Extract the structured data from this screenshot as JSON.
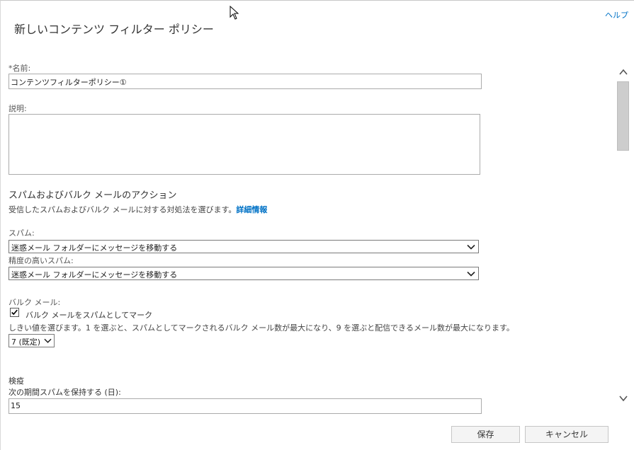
{
  "header": {
    "title": "新しいコンテンツ フィルター ポリシー",
    "help_link": "ヘルプ"
  },
  "form": {
    "name_label": "*名前:",
    "name_value": "コンテンツフィルターポリシー①",
    "description_label": "説明:",
    "description_value": "",
    "spam_section": {
      "title": "スパムおよびバルク メールのアクション",
      "description": "受信したスパムおよびバルク メールに対する対処法を選びます。",
      "more_info_link": "詳細情報",
      "spam_label": "スパム:",
      "spam_selected": "迷惑メール フォルダーにメッセージを移動する",
      "high_confidence_label": "精度の高いスパム:",
      "high_confidence_selected": "迷惑メール フォルダーにメッセージを移動する"
    },
    "bulk_section": {
      "label": "バルク メール:",
      "checkbox_label": "バルク メールをスパムとしてマーク",
      "checkbox_checked": true,
      "threshold_description": "しきい値を選びます。1 を選ぶと、スパムとしてマークされるバルク メール数が最大になり、9 を選ぶと配信できるメール数が最大になります。",
      "threshold_selected": "7 (既定)"
    },
    "quarantine_section": {
      "title": "検疫",
      "retention_label": "次の期間スパムを保持する (日):",
      "retention_value": "15"
    }
  },
  "footer": {
    "save_label": "保存",
    "cancel_label": "キャンセル"
  },
  "icons": {
    "chevron": "chevron-down-icon",
    "scroll_up": "chevron-up-icon",
    "scroll_down": "chevron-down-icon",
    "check": "checkmark-icon",
    "cursor": "mouse-pointer-icon"
  },
  "colors": {
    "link": "#0072c6",
    "text": "#333333"
  }
}
